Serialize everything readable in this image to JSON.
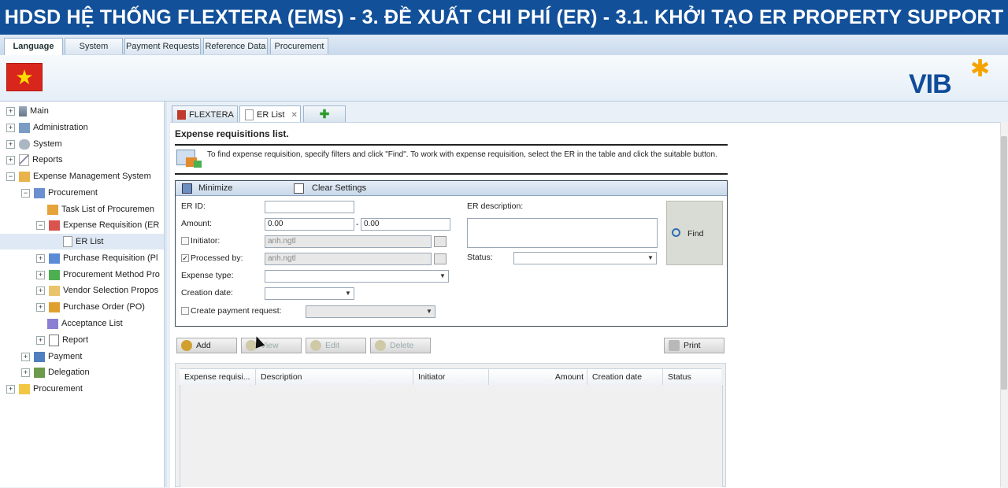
{
  "banner": {
    "title": "HDSD HỆ THỐNG FLEXTERA (EMS) - 3. ĐỀ XUẤT CHI PHÍ (ER) - 3.1. KHỞI TẠO ER PROPERTY SUPPORT HUB"
  },
  "menu": {
    "tabs": [
      "Language",
      "System",
      "Payment Requests",
      "Reference Data",
      "Procurement"
    ],
    "active": "Language"
  },
  "header": {
    "logo_text": "VIB",
    "flag": "vietnam-flag",
    "colors": {
      "brand": "#0f4c9a",
      "accent": "#f5a300"
    }
  },
  "sidebar": {
    "items": [
      {
        "label": "Main"
      },
      {
        "label": "Administration"
      },
      {
        "label": "System"
      },
      {
        "label": "Reports"
      },
      {
        "label": "Expense Management System"
      },
      {
        "label": "Procurement"
      },
      {
        "label": "Task List of Procuremen"
      },
      {
        "label": "Expense Requisition (ER"
      },
      {
        "label": "ER List"
      },
      {
        "label": "Purchase Requisition (Pl"
      },
      {
        "label": "Procurement Method Pro"
      },
      {
        "label": "Vendor Selection Propos"
      },
      {
        "label": "Purchase Order (PO)"
      },
      {
        "label": "Acceptance List"
      },
      {
        "label": "Report"
      },
      {
        "label": "Payment"
      },
      {
        "label": "Delegation"
      },
      {
        "label": "Procurement"
      }
    ]
  },
  "content_tabs": {
    "flextera": "FLEXTERA",
    "er_list": "ER List"
  },
  "page": {
    "title": "Expense requisitions list.",
    "info": "To find expense requisition, specify filters and click \"Find\". To work with expense requisition, select the ER in the table and click the suitable button."
  },
  "filter": {
    "minimize": "Minimize",
    "clear": "Clear Settings",
    "er_id_label": "ER ID:",
    "er_id_value": "",
    "amount_label": "Amount:",
    "amount_from": "0.00",
    "amount_sep": "-",
    "amount_to": "0.00",
    "initiator_label": "Initiator:",
    "initiator_value": "anh.ngtl",
    "processed_label": "Processed by:",
    "processed_value": "anh.ngtl",
    "expense_type_label": "Expense type:",
    "creation_date_label": "Creation date:",
    "create_payment_label": "Create payment request:",
    "description_label": "ER description:",
    "status_label": "Status:",
    "find": "Find"
  },
  "actions": {
    "add": "Add",
    "view": "View",
    "edit": "Edit",
    "delete": "Delete",
    "print": "Print"
  },
  "table": {
    "columns": [
      "Expense requisi...",
      "Description",
      "Initiator",
      "Amount",
      "Creation date",
      "Status"
    ]
  }
}
